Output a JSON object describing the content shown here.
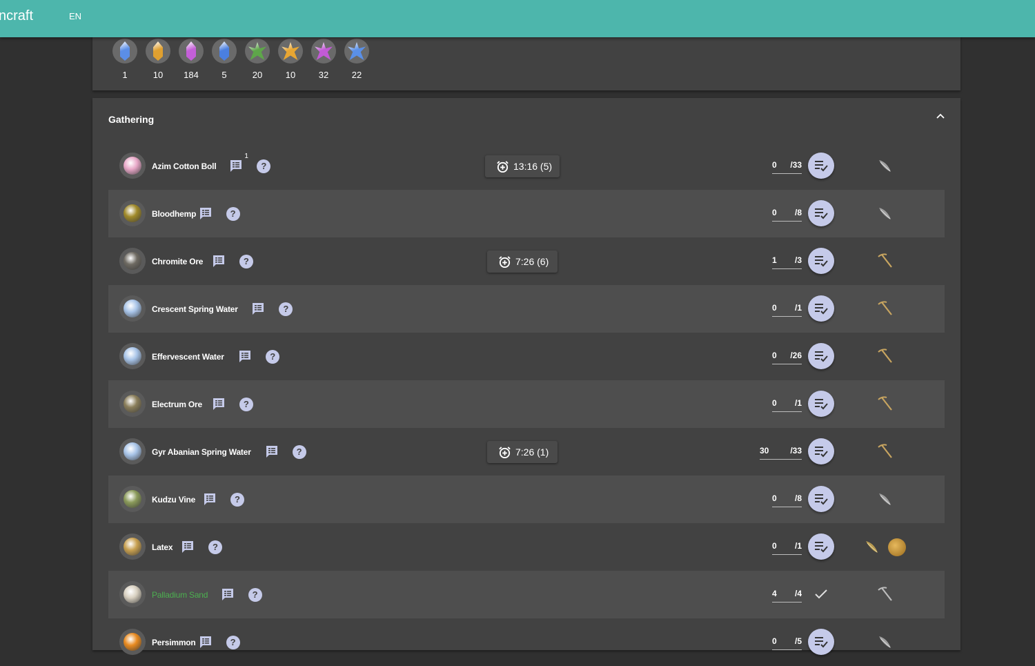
{
  "app": {
    "title": "ncraft",
    "language": "EN"
  },
  "crystals": [
    {
      "count": "1",
      "icon": "blue-shard-icon",
      "color": "#5b8ee6",
      "kind": "shard"
    },
    {
      "count": "10",
      "icon": "yellow-shard-icon",
      "color": "#e0a030",
      "kind": "shard"
    },
    {
      "count": "184",
      "icon": "purple-shard-icon",
      "color": "#c45fd8",
      "kind": "shard"
    },
    {
      "count": "5",
      "icon": "blue-shard-icon",
      "color": "#4a7fe0",
      "kind": "shard"
    },
    {
      "count": "20",
      "icon": "green-cluster-icon",
      "color": "#5ea64a",
      "kind": "cluster"
    },
    {
      "count": "10",
      "icon": "yellow-cluster-icon",
      "color": "#e8a632",
      "kind": "cluster"
    },
    {
      "count": "32",
      "icon": "purple-cluster-icon",
      "color": "#c25ad6",
      "kind": "cluster"
    },
    {
      "count": "22",
      "icon": "blue-cluster-icon",
      "color": "#5a90e8",
      "kind": "cluster"
    }
  ],
  "gathering": {
    "title": "Gathering",
    "items": [
      {
        "name": "Azim Cotton Boll",
        "note_badge": "1",
        "timer": "13:16 (5)",
        "amount": "0",
        "total": "/33",
        "job": "botany",
        "icon_color": "#e8a8c8"
      },
      {
        "name": "Bloodhemp",
        "note_badge": "",
        "timer": "",
        "amount": "0",
        "total": "/8",
        "job": "botany",
        "icon_color": "#a08a2a"
      },
      {
        "name": "Chromite Ore",
        "note_badge": "",
        "timer": "7:26 (6)",
        "amount": "1",
        "total": "/3",
        "job": "mining",
        "icon_color": "#6e6a62"
      },
      {
        "name": "Crescent Spring Water",
        "note_badge": "",
        "timer": "",
        "amount": "0",
        "total": "/1",
        "job": "mining",
        "icon_color": "#a8c4e8"
      },
      {
        "name": "Effervescent Water",
        "note_badge": "",
        "timer": "",
        "amount": "0",
        "total": "/26",
        "job": "mining",
        "icon_color": "#a8c4e8"
      },
      {
        "name": "Electrum Ore",
        "note_badge": "",
        "timer": "",
        "amount": "0",
        "total": "/1",
        "job": "mining",
        "icon_color": "#8a7e5a"
      },
      {
        "name": "Gyr Abanian Spring Water",
        "note_badge": "",
        "timer": "7:26 (1)",
        "amount": "30",
        "total": "/33",
        "job": "mining",
        "icon_color": "#a8c4e8"
      },
      {
        "name": "Kudzu Vine",
        "note_badge": "",
        "timer": "",
        "amount": "0",
        "total": "/8",
        "job": "botany",
        "icon_color": "#8a9a5a"
      },
      {
        "name": "Latex",
        "note_badge": "",
        "timer": "",
        "amount": "0",
        "total": "/1",
        "job": "botany-fishing",
        "icon_color": "#c8a050"
      },
      {
        "name": "Palladium Sand",
        "note_badge": "",
        "timer": "",
        "amount": "4",
        "total": "/4",
        "job": "mining-done",
        "icon_color": "#d8d0c0",
        "done": true
      },
      {
        "name": "Persimmon",
        "note_badge": "",
        "timer": "",
        "amount": "0",
        "total": "/5",
        "job": "botany",
        "icon_color": "#e88a20"
      }
    ]
  }
}
